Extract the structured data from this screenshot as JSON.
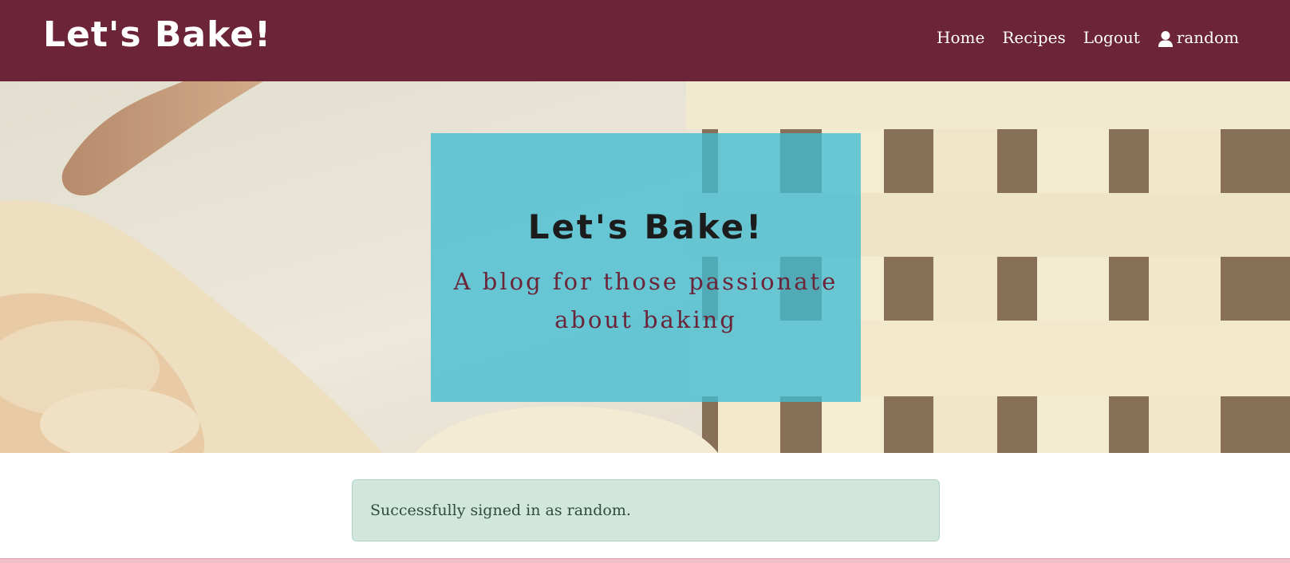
{
  "navbar": {
    "brand": "Let's Bake!",
    "links": {
      "home": "Home",
      "recipes": "Recipes",
      "logout": "Logout",
      "user": "random"
    }
  },
  "hero": {
    "title": "Let's Bake!",
    "subtitle": "A blog for those passionate about baking"
  },
  "alert": {
    "message": "Successfully signed in as random."
  },
  "colors": {
    "navbar": "#6b2438",
    "hero_card": "#40bdd2",
    "subtitle": "#6b2438",
    "alert_bg": "#d1e7dd",
    "bottom_strip": "#f1bfc8"
  },
  "icons": {
    "user": "user-icon"
  }
}
